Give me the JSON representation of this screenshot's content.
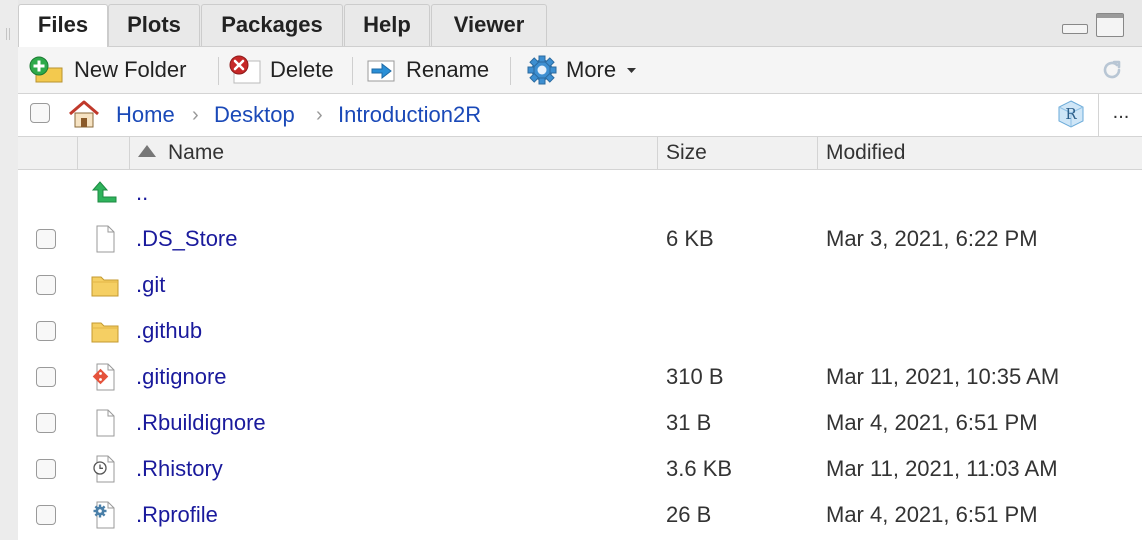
{
  "tabs": [
    {
      "label": "Files",
      "active": true
    },
    {
      "label": "Plots",
      "active": false
    },
    {
      "label": "Packages",
      "active": false
    },
    {
      "label": "Help",
      "active": false
    },
    {
      "label": "Viewer",
      "active": false
    }
  ],
  "toolbar": {
    "new_folder": "New Folder",
    "delete": "Delete",
    "rename": "Rename",
    "more": "More"
  },
  "path": {
    "crumbs": [
      "Home",
      "Desktop",
      "Introduction2R"
    ],
    "project_badge": "R",
    "overflow": "..."
  },
  "columns": {
    "name": "Name",
    "size": "Size",
    "modified": "Modified"
  },
  "parent_row": {
    "name": ".."
  },
  "files": [
    {
      "name": ".DS_Store",
      "size": "6 KB",
      "modified": "Mar 3, 2021, 6:22 PM",
      "icon": "file-icon"
    },
    {
      "name": ".git",
      "size": "",
      "modified": "",
      "icon": "folder-icon"
    },
    {
      "name": ".github",
      "size": "",
      "modified": "",
      "icon": "folder-icon"
    },
    {
      "name": ".gitignore",
      "size": "310 B",
      "modified": "Mar 11, 2021, 10:35 AM",
      "icon": "git-file-icon"
    },
    {
      "name": ".Rbuildignore",
      "size": "31 B",
      "modified": "Mar 4, 2021, 6:51 PM",
      "icon": "file-icon"
    },
    {
      "name": ".Rhistory",
      "size": "3.6 KB",
      "modified": "Mar 11, 2021, 11:03 AM",
      "icon": "history-file-icon"
    },
    {
      "name": ".Rprofile",
      "size": "26 B",
      "modified": "Mar 4, 2021, 6:51 PM",
      "icon": "settings-file-icon"
    }
  ],
  "colors": {
    "link": "#1a1a9c",
    "crumb": "#1a49b8"
  }
}
